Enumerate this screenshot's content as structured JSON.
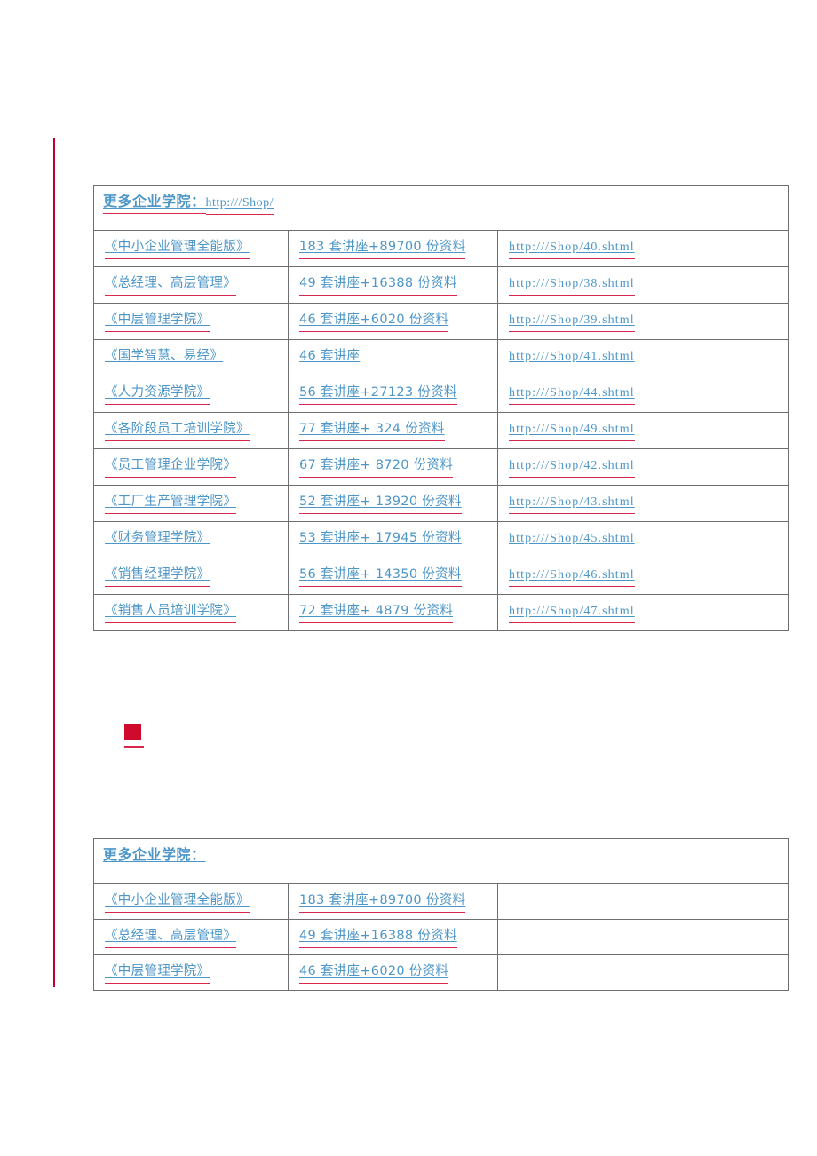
{
  "document": {
    "background_color": "#ffffff",
    "text_color": "#4d96c8",
    "spellcheck_underline_color": "#d8264c",
    "change_bar_color": "#c2002f",
    "marker_color": "#cf0a2c"
  },
  "table1": {
    "header": {
      "title": "更多企业学院：",
      "url": "http:///Shop/"
    },
    "columns": [
      "course",
      "counts",
      "url"
    ],
    "rows": [
      {
        "course": "《中小企业管理全能版》",
        "counts": "183 套讲座+89700 份资料",
        "url": "http:///Shop/40.shtml"
      },
      {
        "course": "《总经理、高层管理》",
        "counts": "49 套讲座+16388 份资料",
        "url": "http:///Shop/38.shtml"
      },
      {
        "course": "《中层管理学院》",
        "counts": "46 套讲座+6020 份资料",
        "url": "http:///Shop/39.shtml"
      },
      {
        "course": "《国学智慧、易经》",
        "counts": "46 套讲座",
        "url": "http:///Shop/41.shtml"
      },
      {
        "course": "《人力资源学院》",
        "counts": "56 套讲座+27123 份资料",
        "url": "http:///Shop/44.shtml"
      },
      {
        "course": "《各阶段员工培训学院》",
        "counts": "77 套讲座+ 324 份资料",
        "url": "http:///Shop/49.shtml"
      },
      {
        "course": "《员工管理企业学院》",
        "counts": "67 套讲座+ 8720 份资料",
        "url": "http:///Shop/42.shtml"
      },
      {
        "course": "《工厂生产管理学院》",
        "counts": "52 套讲座+ 13920 份资料",
        "url": "http:///Shop/43.shtml"
      },
      {
        "course": "《财务管理学院》",
        "counts": "53 套讲座+ 17945 份资料",
        "url": "http:///Shop/45.shtml"
      },
      {
        "course": "《销售经理学院》",
        "counts": "56 套讲座+ 14350 份资料",
        "url": "http:///Shop/46.shtml"
      },
      {
        "course": "《销售人员培训学院》",
        "counts": "72 套讲座+ 4879 份资料",
        "url": "http:///Shop/47.shtml"
      }
    ]
  },
  "marker": {
    "name": "red-square-bullet"
  },
  "table2": {
    "header": {
      "title": "更多企业学院：",
      "url": ""
    },
    "columns": [
      "course",
      "counts",
      "url"
    ],
    "rows": [
      {
        "course": "《中小企业管理全能版》",
        "counts": "183 套讲座+89700 份资料",
        "url": ""
      },
      {
        "course": "《总经理、高层管理》",
        "counts": "49 套讲座+16388 份资料",
        "url": ""
      },
      {
        "course": "《中层管理学院》",
        "counts": "46 套讲座+6020 份资料",
        "url": ""
      }
    ]
  }
}
